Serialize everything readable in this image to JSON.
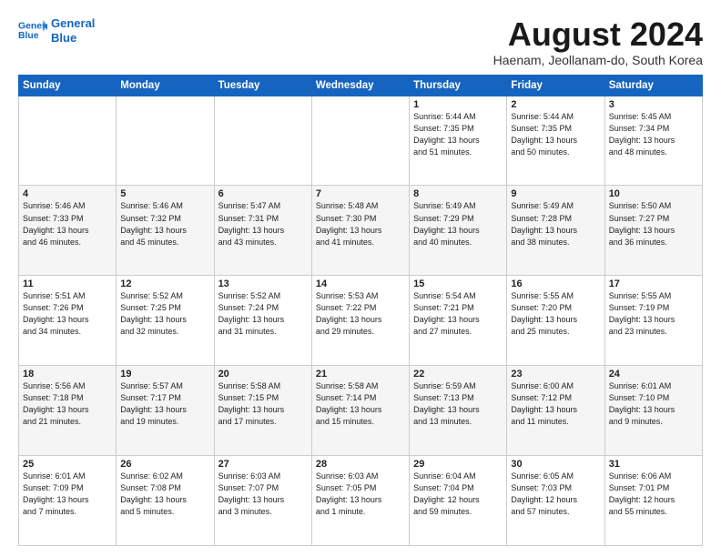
{
  "header": {
    "logo_line1": "General",
    "logo_line2": "Blue",
    "month": "August 2024",
    "location": "Haenam, Jeollanam-do, South Korea"
  },
  "days_of_week": [
    "Sunday",
    "Monday",
    "Tuesday",
    "Wednesday",
    "Thursday",
    "Friday",
    "Saturday"
  ],
  "weeks": [
    [
      {
        "day": "",
        "info": ""
      },
      {
        "day": "",
        "info": ""
      },
      {
        "day": "",
        "info": ""
      },
      {
        "day": "",
        "info": ""
      },
      {
        "day": "1",
        "info": "Sunrise: 5:44 AM\nSunset: 7:35 PM\nDaylight: 13 hours\nand 51 minutes."
      },
      {
        "day": "2",
        "info": "Sunrise: 5:44 AM\nSunset: 7:35 PM\nDaylight: 13 hours\nand 50 minutes."
      },
      {
        "day": "3",
        "info": "Sunrise: 5:45 AM\nSunset: 7:34 PM\nDaylight: 13 hours\nand 48 minutes."
      }
    ],
    [
      {
        "day": "4",
        "info": "Sunrise: 5:46 AM\nSunset: 7:33 PM\nDaylight: 13 hours\nand 46 minutes."
      },
      {
        "day": "5",
        "info": "Sunrise: 5:46 AM\nSunset: 7:32 PM\nDaylight: 13 hours\nand 45 minutes."
      },
      {
        "day": "6",
        "info": "Sunrise: 5:47 AM\nSunset: 7:31 PM\nDaylight: 13 hours\nand 43 minutes."
      },
      {
        "day": "7",
        "info": "Sunrise: 5:48 AM\nSunset: 7:30 PM\nDaylight: 13 hours\nand 41 minutes."
      },
      {
        "day": "8",
        "info": "Sunrise: 5:49 AM\nSunset: 7:29 PM\nDaylight: 13 hours\nand 40 minutes."
      },
      {
        "day": "9",
        "info": "Sunrise: 5:49 AM\nSunset: 7:28 PM\nDaylight: 13 hours\nand 38 minutes."
      },
      {
        "day": "10",
        "info": "Sunrise: 5:50 AM\nSunset: 7:27 PM\nDaylight: 13 hours\nand 36 minutes."
      }
    ],
    [
      {
        "day": "11",
        "info": "Sunrise: 5:51 AM\nSunset: 7:26 PM\nDaylight: 13 hours\nand 34 minutes."
      },
      {
        "day": "12",
        "info": "Sunrise: 5:52 AM\nSunset: 7:25 PM\nDaylight: 13 hours\nand 32 minutes."
      },
      {
        "day": "13",
        "info": "Sunrise: 5:52 AM\nSunset: 7:24 PM\nDaylight: 13 hours\nand 31 minutes."
      },
      {
        "day": "14",
        "info": "Sunrise: 5:53 AM\nSunset: 7:22 PM\nDaylight: 13 hours\nand 29 minutes."
      },
      {
        "day": "15",
        "info": "Sunrise: 5:54 AM\nSunset: 7:21 PM\nDaylight: 13 hours\nand 27 minutes."
      },
      {
        "day": "16",
        "info": "Sunrise: 5:55 AM\nSunset: 7:20 PM\nDaylight: 13 hours\nand 25 minutes."
      },
      {
        "day": "17",
        "info": "Sunrise: 5:55 AM\nSunset: 7:19 PM\nDaylight: 13 hours\nand 23 minutes."
      }
    ],
    [
      {
        "day": "18",
        "info": "Sunrise: 5:56 AM\nSunset: 7:18 PM\nDaylight: 13 hours\nand 21 minutes."
      },
      {
        "day": "19",
        "info": "Sunrise: 5:57 AM\nSunset: 7:17 PM\nDaylight: 13 hours\nand 19 minutes."
      },
      {
        "day": "20",
        "info": "Sunrise: 5:58 AM\nSunset: 7:15 PM\nDaylight: 13 hours\nand 17 minutes."
      },
      {
        "day": "21",
        "info": "Sunrise: 5:58 AM\nSunset: 7:14 PM\nDaylight: 13 hours\nand 15 minutes."
      },
      {
        "day": "22",
        "info": "Sunrise: 5:59 AM\nSunset: 7:13 PM\nDaylight: 13 hours\nand 13 minutes."
      },
      {
        "day": "23",
        "info": "Sunrise: 6:00 AM\nSunset: 7:12 PM\nDaylight: 13 hours\nand 11 minutes."
      },
      {
        "day": "24",
        "info": "Sunrise: 6:01 AM\nSunset: 7:10 PM\nDaylight: 13 hours\nand 9 minutes."
      }
    ],
    [
      {
        "day": "25",
        "info": "Sunrise: 6:01 AM\nSunset: 7:09 PM\nDaylight: 13 hours\nand 7 minutes."
      },
      {
        "day": "26",
        "info": "Sunrise: 6:02 AM\nSunset: 7:08 PM\nDaylight: 13 hours\nand 5 minutes."
      },
      {
        "day": "27",
        "info": "Sunrise: 6:03 AM\nSunset: 7:07 PM\nDaylight: 13 hours\nand 3 minutes."
      },
      {
        "day": "28",
        "info": "Sunrise: 6:03 AM\nSunset: 7:05 PM\nDaylight: 13 hours\nand 1 minute."
      },
      {
        "day": "29",
        "info": "Sunrise: 6:04 AM\nSunset: 7:04 PM\nDaylight: 12 hours\nand 59 minutes."
      },
      {
        "day": "30",
        "info": "Sunrise: 6:05 AM\nSunset: 7:03 PM\nDaylight: 12 hours\nand 57 minutes."
      },
      {
        "day": "31",
        "info": "Sunrise: 6:06 AM\nSunset: 7:01 PM\nDaylight: 12 hours\nand 55 minutes."
      }
    ]
  ]
}
